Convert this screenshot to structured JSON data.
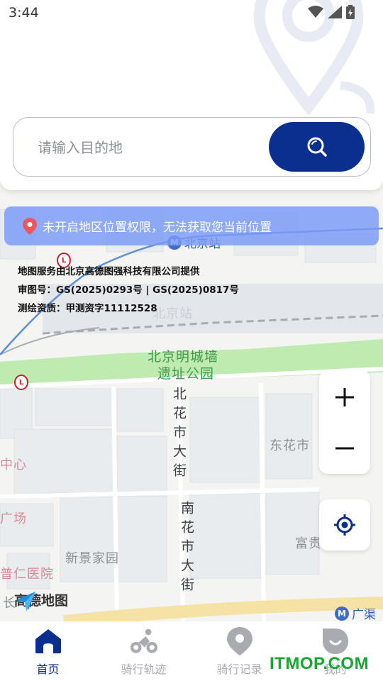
{
  "status_bar": {
    "time": "3:44"
  },
  "search": {
    "placeholder": "请输入目的地"
  },
  "notice": {
    "text": "未开启地区位置权限，无法获取您当前位置"
  },
  "map": {
    "station_badge": "北京站",
    "station_label": "北京站",
    "park_label_line1": "北京明城墙",
    "park_label_line2": "遗址公园",
    "street_north": "北花市大街",
    "street_south": "南花市大街",
    "label_donghuashi": "东花市",
    "label_center": "中心",
    "label_guangchang": "广场",
    "label_xinjing": "新景家园",
    "label_fugui": "富贵",
    "label_hospital": "普仁医院",
    "label_chang": "长",
    "label_guangqu": "广渠",
    "sinopec_1": "L",
    "sinopec_2": "L",
    "attribution_line1": "地图服务由北京高德图强科技有限公司提供",
    "attribution_line2": "审图号：GS(2025)0293号 | GS(2025)0817号",
    "attribution_line3": "测绘资质：甲测资字11112528",
    "logo_text": "高德地图"
  },
  "controls": {
    "zoom_in": "+",
    "zoom_out": "−"
  },
  "nav": {
    "items": [
      {
        "label": "首页",
        "icon": "home-icon",
        "active": true
      },
      {
        "label": "骑行轨迹",
        "icon": "cyclist-icon",
        "active": false
      },
      {
        "label": "骑行记录",
        "icon": "location-pin-icon",
        "active": false
      },
      {
        "label": "我的",
        "icon": "profile-icon",
        "active": false
      }
    ]
  },
  "watermark": "ITMOP.COM",
  "colors": {
    "primary": "#0a2f8f",
    "notice_bg": "#799af7",
    "inactive": "#a9abb0"
  }
}
